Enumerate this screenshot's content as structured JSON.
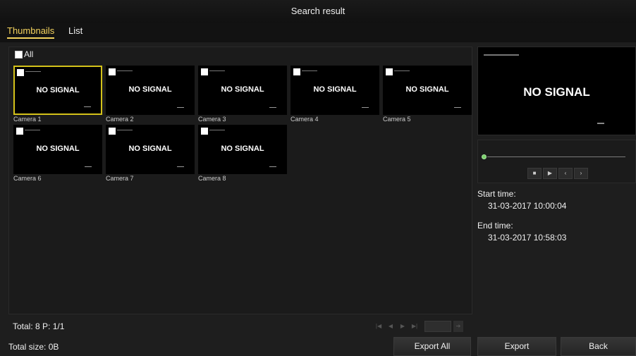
{
  "title": "Search result",
  "tabs": [
    {
      "label": "Thumbnails",
      "active": true
    },
    {
      "label": "List",
      "active": false
    }
  ],
  "select_all_label": "All",
  "thumbnails": [
    {
      "camera": "Camera 1",
      "status": "NO SIGNAL",
      "selected": true
    },
    {
      "camera": "Camera 2",
      "status": "NO SIGNAL",
      "selected": false
    },
    {
      "camera": "Camera 3",
      "status": "NO SIGNAL",
      "selected": false
    },
    {
      "camera": "Camera 4",
      "status": "NO SIGNAL",
      "selected": false
    },
    {
      "camera": "Camera 5",
      "status": "NO SIGNAL",
      "selected": false
    },
    {
      "camera": "Camera 6",
      "status": "NO SIGNAL",
      "selected": false
    },
    {
      "camera": "Camera 7",
      "status": "NO SIGNAL",
      "selected": false
    },
    {
      "camera": "Camera 8",
      "status": "NO SIGNAL",
      "selected": false
    }
  ],
  "totals": "Total: 8  P: 1/1",
  "total_size": "Total size: 0B",
  "pager_icons": [
    "first-page-icon",
    "prev-page-icon",
    "next-page-icon",
    "last-page-icon",
    "go-icon"
  ],
  "preview": {
    "status": "NO SIGNAL"
  },
  "playback": {
    "controls": [
      "stop-icon",
      "play-icon",
      "prev-icon",
      "next-icon"
    ]
  },
  "start_time_label": "Start time:",
  "start_time": "31-03-2017 10:00:04",
  "end_time_label": "End time:",
  "end_time": "31-03-2017 10:58:03",
  "buttons": {
    "export_all": "Export All",
    "export": "Export",
    "back": "Back"
  },
  "colors": {
    "accent": "#f4d35e",
    "selection_border": "#d4c21a",
    "background": "#1e1e1e"
  }
}
